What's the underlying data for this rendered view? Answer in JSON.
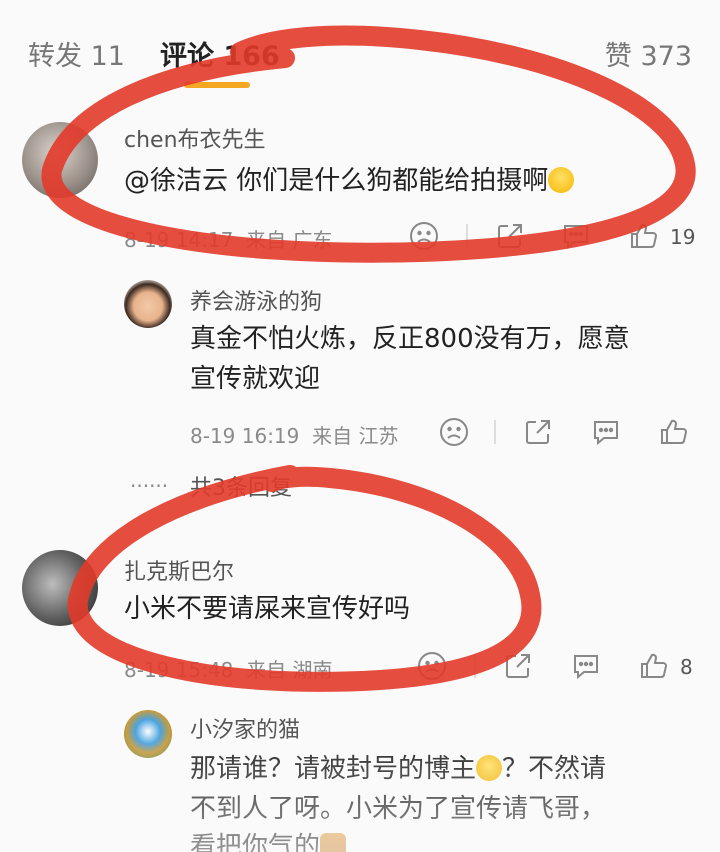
{
  "tabs": {
    "repost": "转发 11",
    "comments": "评论 166",
    "likes": "赞 373"
  },
  "comments": [
    {
      "username": "chen布衣先生",
      "text": "@徐洁云 你们是什么狗都能给拍摄啊",
      "time": "8-19 14:17",
      "location": "来自 广东",
      "likes": "19"
    },
    {
      "username": "养会游泳的狗",
      "text_line1": "真金不怕火炼，反正800没有万，愿意",
      "text_line2": "宣传就欢迎",
      "time": "8-19 16:19",
      "location": "来自 江苏",
      "likes": ""
    },
    {
      "username": "扎克斯巴尔",
      "text": "小米不要请屎来宣传好吗",
      "time": "8-19 15:48",
      "location": "来自 湖南",
      "likes": "8"
    },
    {
      "username": "小汐家的猫",
      "text_line1a": "那请谁？请被封号的博主",
      "text_line1b": "？不然请",
      "text_line2": "不到人了呀。小米为了宣传请飞哥，",
      "text_line3": "看把你气的"
    }
  ],
  "replies_summary": {
    "dots": "······",
    "label": "共3条回复"
  },
  "colors": {
    "annotation_red": "#e23a2a",
    "tab_indicator": "#f5a623"
  }
}
